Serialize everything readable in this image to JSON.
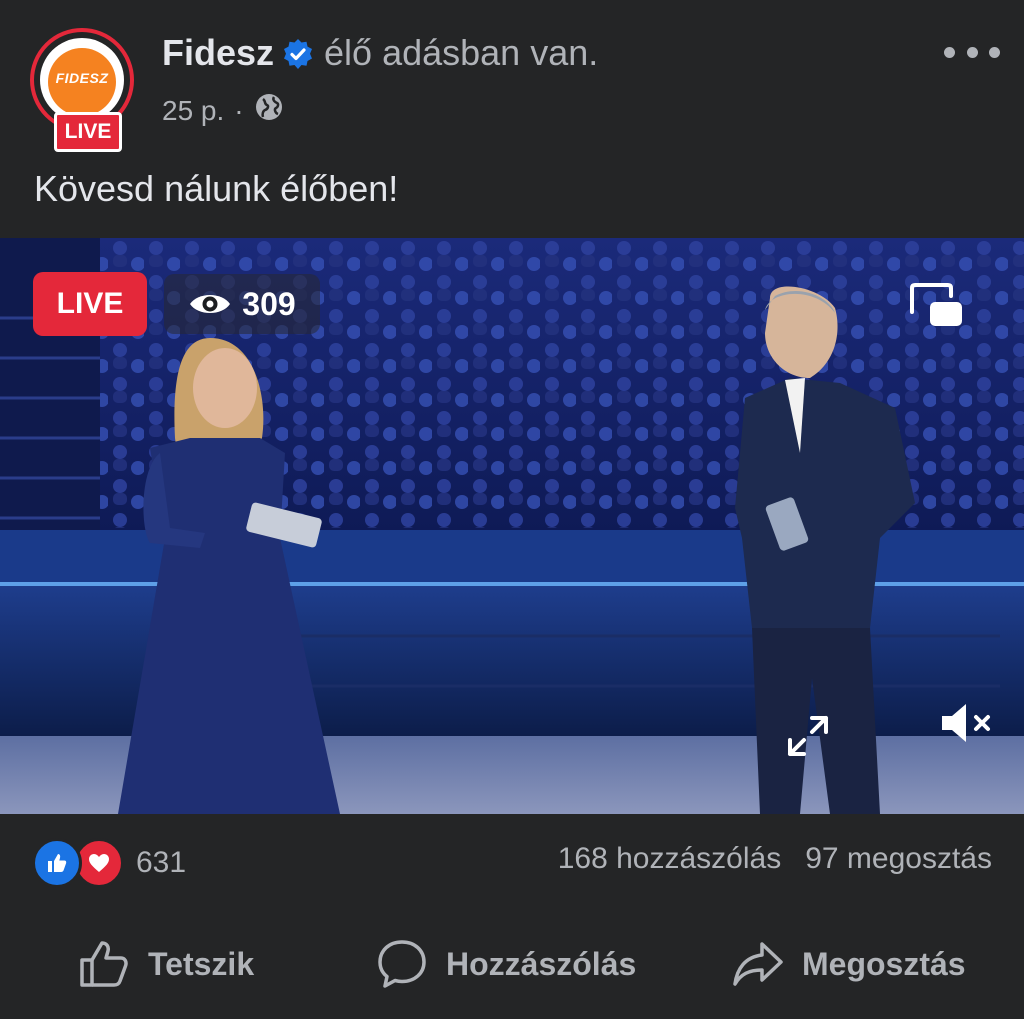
{
  "post": {
    "page_name": "Fidesz",
    "status": "élő adásban van.",
    "time": "25 p.",
    "separator": "·",
    "text": "Kövesd nálunk élőben!",
    "avatar_logo_text": "FIDESZ",
    "avatar_live_text": "LIVE"
  },
  "video": {
    "live_label": "LIVE",
    "viewer_count": "309"
  },
  "stats": {
    "reaction_count": "631",
    "comments": "168 hozzászólás",
    "shares": "97 megosztás"
  },
  "actions": {
    "like": "Tetszik",
    "comment": "Hozzászólás",
    "share": "Megosztás"
  },
  "icons": {
    "verified": "verified-badge-icon",
    "audience": "globe-icon",
    "more": "more-options-icon",
    "viewers": "eye-icon",
    "pip": "picture-in-picture-icon",
    "expand": "expand-icon",
    "mute": "muted-speaker-icon",
    "like_reaction": "like-reaction-icon",
    "love_reaction": "love-reaction-icon",
    "like_action": "thumbs-up-icon",
    "comment_action": "speech-bubble-icon",
    "share_action": "share-arrow-icon"
  },
  "colors": {
    "background": "#242526",
    "primary_text": "#e4e6eb",
    "secondary_text": "#b0b3b8",
    "live_red": "#e4283a",
    "verified_blue": "#1b74e4",
    "fidesz_orange": "#f58220"
  }
}
